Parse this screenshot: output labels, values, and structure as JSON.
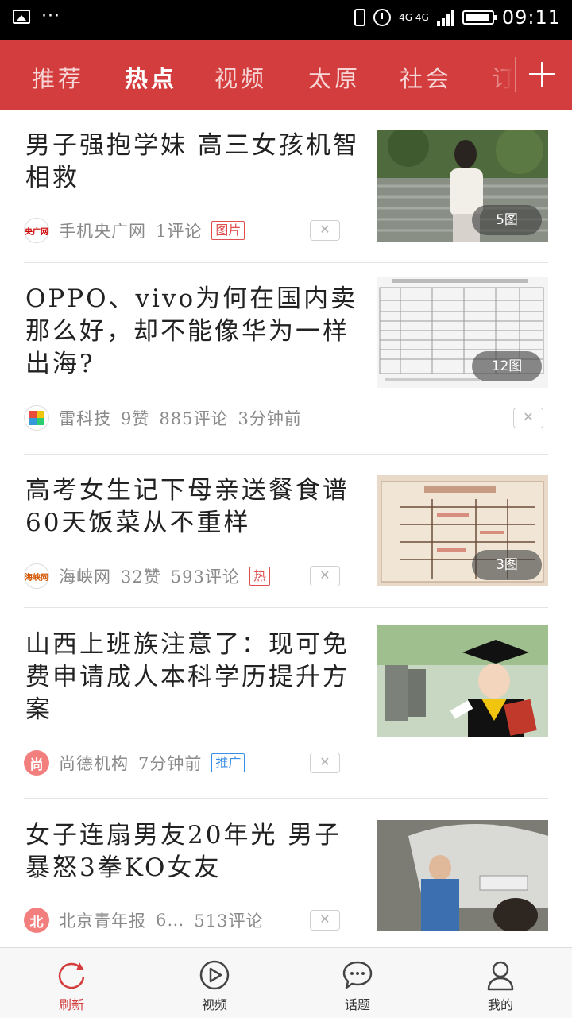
{
  "status_bar": {
    "time": "09:11",
    "network": "4G 4G"
  },
  "colors": {
    "brand_red": "#d43d3d",
    "tag_red": "#e05050",
    "tag_blue": "#3a8ee6"
  },
  "tabs": [
    {
      "label": "推荐"
    },
    {
      "label": "热点",
      "active": true
    },
    {
      "label": "视频"
    },
    {
      "label": "太原"
    },
    {
      "label": "社会"
    },
    {
      "label": "订阅"
    }
  ],
  "icons": {
    "add_channel": "plus-icon",
    "dismiss": "close-icon"
  },
  "news": [
    {
      "title": "男子强抱学妹 高三女孩机智相救",
      "source": "手机央广网",
      "likes": "",
      "comments": "1评论",
      "time": "",
      "tag": "图片",
      "image_count": "5图",
      "close": "✕"
    },
    {
      "title": "OPPO、vivo为何在国内卖那么好，却不能像华为一样出海?",
      "source": "雷科技",
      "likes": "9赞",
      "comments": "885评论",
      "time": "3分钟前",
      "tag": "",
      "image_count": "12图",
      "close": "✕"
    },
    {
      "title": "高考女生记下母亲送餐食谱 60天饭菜从不重样",
      "source": "海峡网",
      "likes": "32赞",
      "comments": "593评论",
      "time": "",
      "tag": "热",
      "image_count": "3图",
      "close": "✕"
    },
    {
      "title": "山西上班族注意了：现可免费申请成人本科学历提升方案",
      "source": "尚德机构",
      "logo_char": "尚",
      "likes": "",
      "comments": "",
      "time": "7分钟前",
      "tag": "推广",
      "image_count": "",
      "close": "✕"
    },
    {
      "title": "女子连扇男友20年光 男子暴怒3拳KO女友",
      "source": "北京青年报",
      "logo_char": "北",
      "likes": "6…",
      "comments": "513评论",
      "time": "",
      "tag": "",
      "image_count": "",
      "close": "✕"
    }
  ],
  "bottom_nav": [
    {
      "label": "刷新",
      "icon": "refresh-icon",
      "active": true
    },
    {
      "label": "视频",
      "icon": "play-icon"
    },
    {
      "label": "话题",
      "icon": "chat-icon"
    },
    {
      "label": "我的",
      "icon": "user-icon"
    }
  ]
}
